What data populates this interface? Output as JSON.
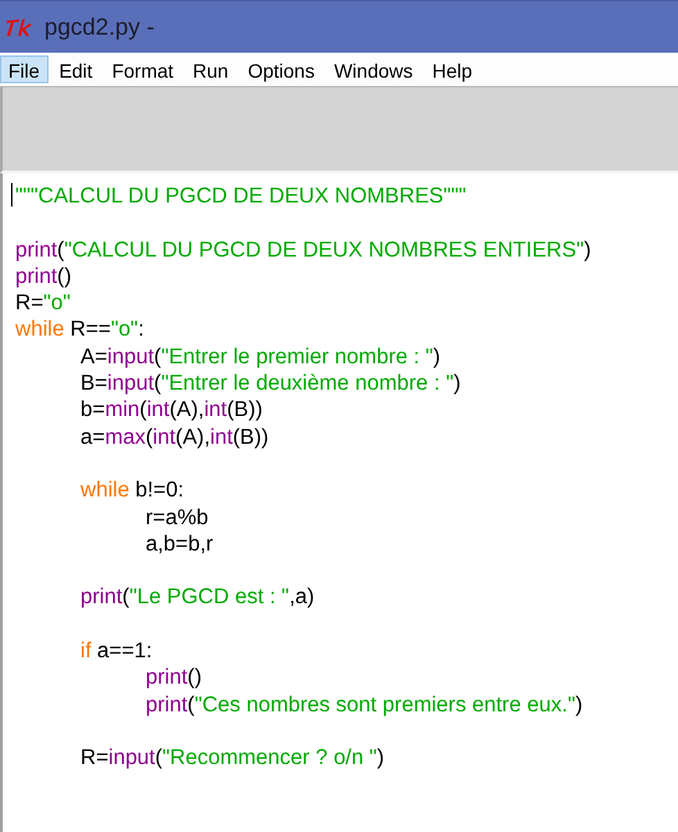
{
  "window": {
    "title": "pgcd2.py -"
  },
  "menu": [
    {
      "label": "File",
      "selected": true
    },
    {
      "label": "Edit",
      "selected": false
    },
    {
      "label": "Format",
      "selected": false
    },
    {
      "label": "Run",
      "selected": false
    },
    {
      "label": "Options",
      "selected": false
    },
    {
      "label": "Windows",
      "selected": false
    },
    {
      "label": "Help",
      "selected": false
    }
  ],
  "editor": {
    "lines": [
      {
        "kind": "code",
        "tokens": [
          {
            "kind": "string",
            "text": "\"\"\"CALCUL DU PGCD DE DEUX NOMBRES\"\"\""
          }
        ]
      },
      {
        "kind": "blank"
      },
      {
        "kind": "code",
        "tokens": [
          {
            "kind": "builtin",
            "text": "print"
          },
          {
            "kind": "plain",
            "text": "("
          },
          {
            "kind": "string",
            "text": "\"CALCUL DU PGCD DE DEUX NOMBRES ENTIERS\""
          },
          {
            "kind": "plain",
            "text": ")"
          }
        ]
      },
      {
        "kind": "code",
        "tokens": [
          {
            "kind": "builtin",
            "text": "print"
          },
          {
            "kind": "plain",
            "text": "()"
          }
        ]
      },
      {
        "kind": "code",
        "tokens": [
          {
            "kind": "plain",
            "text": "R="
          },
          {
            "kind": "string",
            "text": "\"o\""
          }
        ]
      },
      {
        "kind": "code",
        "tokens": [
          {
            "kind": "keyword",
            "text": "while"
          },
          {
            "kind": "plain",
            "text": " R=="
          },
          {
            "kind": "string",
            "text": "\"o\""
          },
          {
            "kind": "plain",
            "text": ":"
          }
        ],
        "children": [
          {
            "kind": "code",
            "tokens": [
              {
                "kind": "plain",
                "text": "A="
              },
              {
                "kind": "builtin",
                "text": "input"
              },
              {
                "kind": "plain",
                "text": "("
              },
              {
                "kind": "string",
                "text": "\"Entrer le premier nombre : \""
              },
              {
                "kind": "plain",
                "text": ")"
              }
            ]
          },
          {
            "kind": "code",
            "tokens": [
              {
                "kind": "plain",
                "text": "B="
              },
              {
                "kind": "builtin",
                "text": "input"
              },
              {
                "kind": "plain",
                "text": "("
              },
              {
                "kind": "string",
                "text": "\"Entrer le deuxième nombre : \""
              },
              {
                "kind": "plain",
                "text": ")"
              }
            ]
          },
          {
            "kind": "code",
            "tokens": [
              {
                "kind": "plain",
                "text": "b="
              },
              {
                "kind": "builtin",
                "text": "min"
              },
              {
                "kind": "plain",
                "text": "("
              },
              {
                "kind": "builtin",
                "text": "int"
              },
              {
                "kind": "plain",
                "text": "(A),"
              },
              {
                "kind": "builtin",
                "text": "int"
              },
              {
                "kind": "plain",
                "text": "(B))"
              }
            ]
          },
          {
            "kind": "code",
            "tokens": [
              {
                "kind": "plain",
                "text": "a="
              },
              {
                "kind": "builtin",
                "text": "max"
              },
              {
                "kind": "plain",
                "text": "("
              },
              {
                "kind": "builtin",
                "text": "int"
              },
              {
                "kind": "plain",
                "text": "(A),"
              },
              {
                "kind": "builtin",
                "text": "int"
              },
              {
                "kind": "plain",
                "text": "(B))"
              }
            ]
          },
          {
            "kind": "blank"
          },
          {
            "kind": "code",
            "tokens": [
              {
                "kind": "keyword",
                "text": "while"
              },
              {
                "kind": "plain",
                "text": " b!=0:"
              }
            ],
            "children": [
              {
                "kind": "code",
                "tokens": [
                  {
                    "kind": "plain",
                    "text": "r=a%b"
                  }
                ]
              },
              {
                "kind": "code",
                "tokens": [
                  {
                    "kind": "plain",
                    "text": "a,b=b,r"
                  }
                ]
              }
            ]
          },
          {
            "kind": "blank"
          },
          {
            "kind": "code",
            "tokens": [
              {
                "kind": "builtin",
                "text": "print"
              },
              {
                "kind": "plain",
                "text": "("
              },
              {
                "kind": "string",
                "text": "\"Le PGCD est : \""
              },
              {
                "kind": "plain",
                "text": ",a)"
              }
            ]
          },
          {
            "kind": "blank"
          },
          {
            "kind": "code",
            "tokens": [
              {
                "kind": "keyword",
                "text": "if"
              },
              {
                "kind": "plain",
                "text": " a==1:"
              }
            ],
            "children": [
              {
                "kind": "code",
                "tokens": [
                  {
                    "kind": "builtin",
                    "text": "print"
                  },
                  {
                    "kind": "plain",
                    "text": "()"
                  }
                ]
              },
              {
                "kind": "code",
                "tokens": [
                  {
                    "kind": "builtin",
                    "text": "print"
                  },
                  {
                    "kind": "plain",
                    "text": "("
                  },
                  {
                    "kind": "string",
                    "text": "\"Ces nombres sont premiers entre eux.\""
                  },
                  {
                    "kind": "plain",
                    "text": ")"
                  }
                ]
              }
            ]
          },
          {
            "kind": "blank"
          },
          {
            "kind": "code",
            "tokens": [
              {
                "kind": "plain",
                "text": "R="
              },
              {
                "kind": "builtin",
                "text": "input"
              },
              {
                "kind": "plain",
                "text": "("
              },
              {
                "kind": "string",
                "text": "\"Recommencer ? o/n \""
              },
              {
                "kind": "plain",
                "text": ")"
              }
            ]
          }
        ]
      }
    ]
  }
}
